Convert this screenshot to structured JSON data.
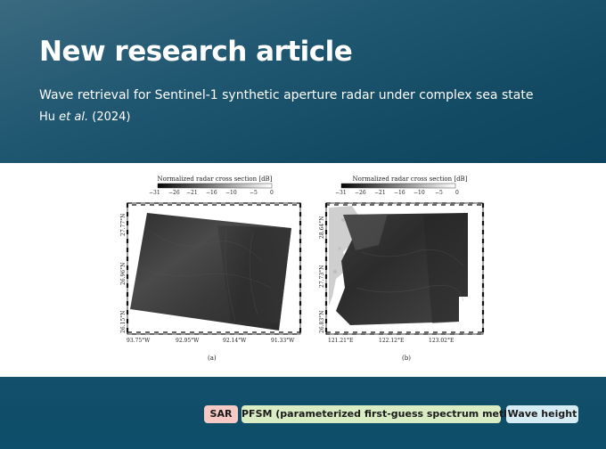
{
  "header": {
    "title": "New research article",
    "subtitle": "Wave retrieval for Sentinel-1 synthetic aperture radar under complex sea state",
    "author_name": "Hu",
    "author_etal": "et al.",
    "year": "(2024)"
  },
  "figure": {
    "panels": [
      {
        "colorbar_title": "Normalized radar cross section [dB]",
        "colorbar_ticks": [
          "−31",
          "−26",
          "−21",
          "−16",
          "−10",
          "−5",
          "0"
        ],
        "lat_labels": [
          "27.77°N",
          "26.96°N",
          "26.15°N"
        ],
        "lon_labels": [
          "93.75°W",
          "92.95°W",
          "92.14°W",
          "91.33°W"
        ],
        "caption": "(a)"
      },
      {
        "colorbar_title": "Normalized radar cross section [dB]",
        "colorbar_ticks": [
          "−31",
          "−26",
          "−21",
          "−16",
          "−10",
          "−5",
          "0"
        ],
        "lat_labels": [
          "28.64°N",
          "27.73°N",
          "26.83°N"
        ],
        "lon_labels": [
          "121.21°E",
          "122.12°E",
          "123.02°E"
        ],
        "caption": "(b)"
      }
    ]
  },
  "tags": {
    "sar": "SAR",
    "pfsm": "PFSM (parameterized first-guess spectrum method)",
    "wave": "Wave height"
  }
}
